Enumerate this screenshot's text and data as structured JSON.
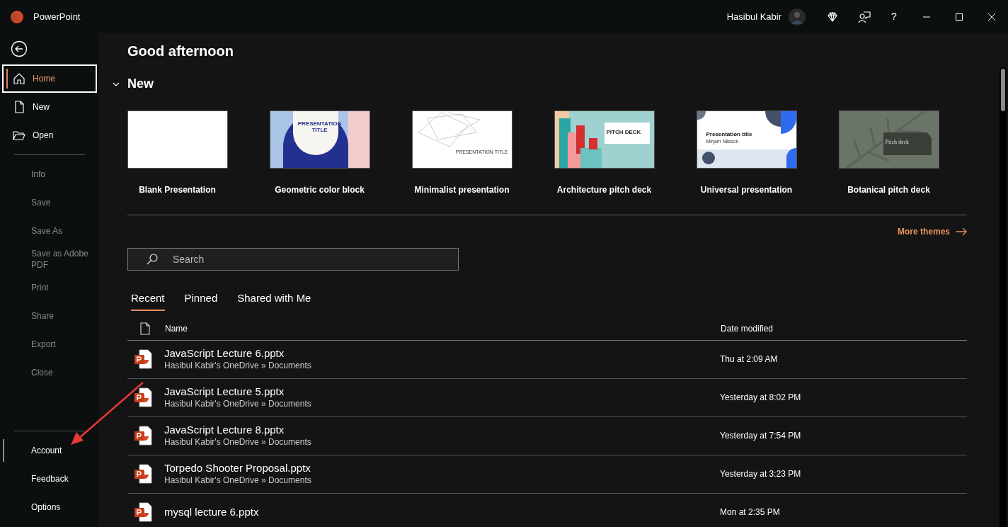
{
  "window": {
    "app_name": "PowerPoint",
    "user_name": "Hasibul Kabir",
    "controls": [
      "?"
    ]
  },
  "sidebar": {
    "items": [
      {
        "label": "Home",
        "kind": "home",
        "selected": true,
        "disabled": false,
        "hovered": false
      },
      {
        "label": "New",
        "kind": "document",
        "selected": false,
        "disabled": false,
        "hovered": false
      },
      {
        "label": "Open",
        "kind": "folder",
        "selected": false,
        "disabled": false,
        "hovered": false
      },
      {
        "kind": "divider"
      },
      {
        "label": "Info",
        "kind": "text",
        "selected": false,
        "disabled": true,
        "hovered": false
      },
      {
        "label": "Save",
        "kind": "text",
        "selected": false,
        "disabled": true,
        "hovered": false
      },
      {
        "label": "Save As",
        "kind": "text",
        "selected": false,
        "disabled": true,
        "hovered": false
      },
      {
        "label": "Save as Adobe PDF",
        "kind": "text",
        "selected": false,
        "disabled": true,
        "hovered": false
      },
      {
        "label": "Print",
        "kind": "text",
        "selected": false,
        "disabled": true,
        "hovered": false
      },
      {
        "label": "Share",
        "kind": "text",
        "selected": false,
        "disabled": true,
        "hovered": false
      },
      {
        "label": "Export",
        "kind": "text",
        "selected": false,
        "disabled": true,
        "hovered": false
      },
      {
        "label": "Close",
        "kind": "text",
        "selected": false,
        "disabled": true,
        "hovered": false
      },
      {
        "kind": "spacer"
      },
      {
        "kind": "divider"
      },
      {
        "label": "Account",
        "kind": "text",
        "selected": false,
        "disabled": false,
        "hovered": true
      },
      {
        "label": "Feedback",
        "kind": "text",
        "selected": false,
        "disabled": false,
        "hovered": false
      },
      {
        "label": "Options",
        "kind": "text",
        "selected": false,
        "disabled": false,
        "hovered": false
      }
    ]
  },
  "greeting": "Good afternoon",
  "new_section": {
    "title": "New",
    "expanded": true,
    "more_link": "More themes",
    "templates": [
      {
        "name": "Blank Presentation",
        "kind": "blank"
      },
      {
        "name": "Geometric color block",
        "kind": "geometric",
        "slide_title": "PRESENTATION TITLE"
      },
      {
        "name": "Minimalist presentation",
        "kind": "minimalist",
        "slide_title": "PRESENTATION TITLE"
      },
      {
        "name": "Architecture pitch deck",
        "kind": "architecture",
        "slide_title": "PITCH DECK"
      },
      {
        "name": "Universal presentation",
        "kind": "universal",
        "slide_title": "Presentation title",
        "slide_subtitle": "Mirjam Nilsson"
      },
      {
        "name": "Botanical pitch deck",
        "kind": "botanical",
        "slide_title": "Pitch deck"
      }
    ]
  },
  "search": {
    "placeholder": "Search"
  },
  "tabs": [
    {
      "label": "Recent",
      "selected": true
    },
    {
      "label": "Pinned",
      "selected": false
    },
    {
      "label": "Shared with Me",
      "selected": false
    }
  ],
  "table": {
    "columns": [
      "Name",
      "Date modified"
    ],
    "rows": [
      {
        "name": "JavaScript Lecture 6.pptx",
        "path": "Hasibul Kabir's OneDrive » Documents",
        "date": "Thu at 2:09 AM"
      },
      {
        "name": "JavaScript Lecture 5.pptx",
        "path": "Hasibul Kabir's OneDrive » Documents",
        "date": "Yesterday at 8:02 PM"
      },
      {
        "name": "JavaScript Lecture 8.pptx",
        "path": "Hasibul Kabir's OneDrive » Documents",
        "date": "Yesterday at 7:54 PM"
      },
      {
        "name": "Torpedo Shooter Proposal.pptx",
        "path": "Hasibul Kabir's OneDrive » Documents",
        "date": "Yesterday at 3:23 PM"
      },
      {
        "name": "mysql lecture 6.pptx",
        "date": "Mon at 2:35 PM"
      }
    ]
  }
}
